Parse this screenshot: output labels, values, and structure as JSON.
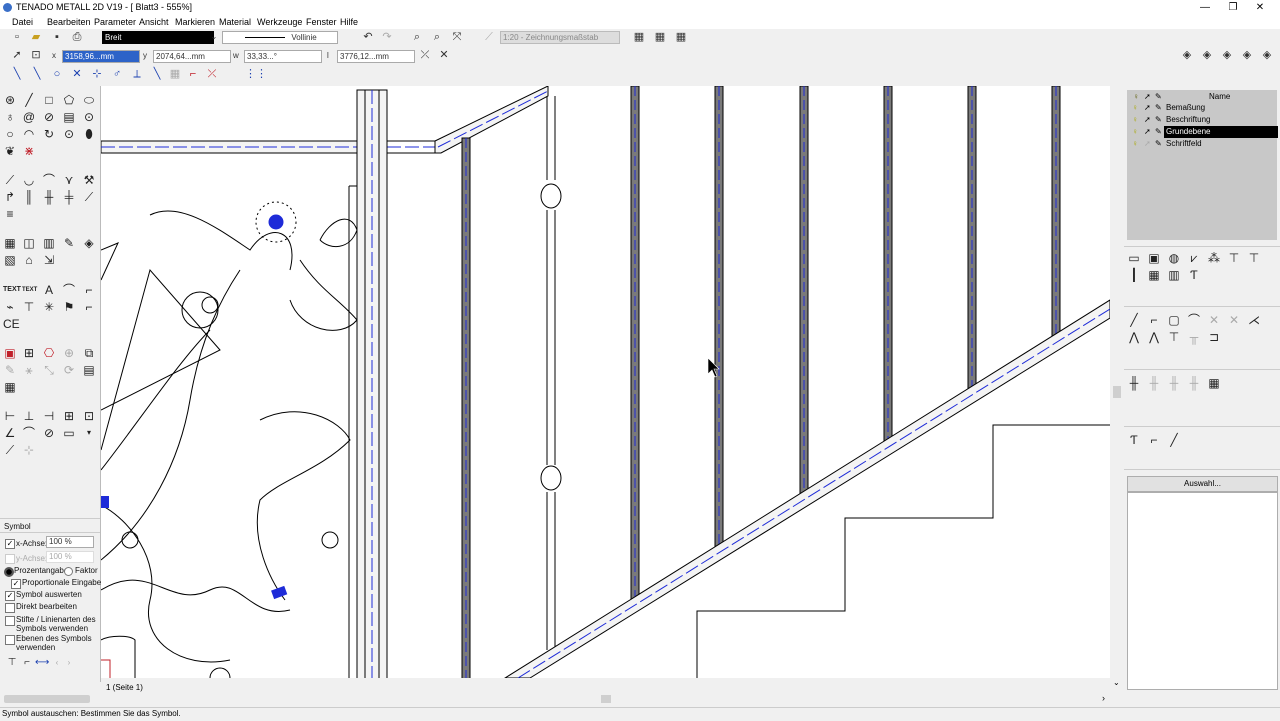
{
  "window": {
    "title": "TENADO METALL 2D V19 - [ Blatt3 - 555%]",
    "minimize": "—",
    "maximize": "❐",
    "close": "✕"
  },
  "menu": [
    "Datei",
    "Bearbeiten",
    "Parameter",
    "Ansicht",
    "Markieren",
    "Material",
    "Werkzeuge",
    "Fenster",
    "Hilfe"
  ],
  "toolbar": {
    "pen_width": "Breit",
    "line_type": "Vollinie",
    "scale": "1:20 - Zeichnungsmaßstab"
  },
  "coords": {
    "x_label": "x",
    "x_value": "3158,96...mm",
    "y_label": "y",
    "y_value": "2074,64...mm",
    "w_label": "w",
    "w_value": "33,33...°",
    "l_label": "l",
    "l_value": "3776,12...mm"
  },
  "symbol_panel": {
    "header": "Symbol",
    "x_axis_label": "x-Achse:",
    "x_axis_value": "100 %",
    "y_axis_label": "y-Achse:",
    "y_axis_value": "100 %",
    "radio_percent": "Prozentangabe",
    "radio_factor": "Faktor",
    "proportional": "Proportionale Eingabe",
    "evaluate": "Symbol auswerten",
    "direct_edit": "Direkt bearbeiten",
    "pens_line1": "Stifte / Linienarten des",
    "pens_line2": "Symbols verwenden",
    "layers_line1": "Ebenen des Symbols",
    "layers_line2": "verwenden"
  },
  "layers": {
    "header": "Name",
    "items": [
      {
        "name": "Bemaßung",
        "selected": false
      },
      {
        "name": "Beschriftung",
        "selected": false
      },
      {
        "name": "Grundebene",
        "selected": true
      },
      {
        "name": "Schriftfeld",
        "selected": false
      }
    ]
  },
  "selection_button": "Auswahl...",
  "page_tab": "1 (Seite 1)",
  "status_text": "Symbol austauschen: Bestimmen Sie das Symbol.",
  "colors": {
    "accent_blue": "#1e2bd8",
    "selection_black": "#000000",
    "rail_gray": "#7a7a7a"
  }
}
